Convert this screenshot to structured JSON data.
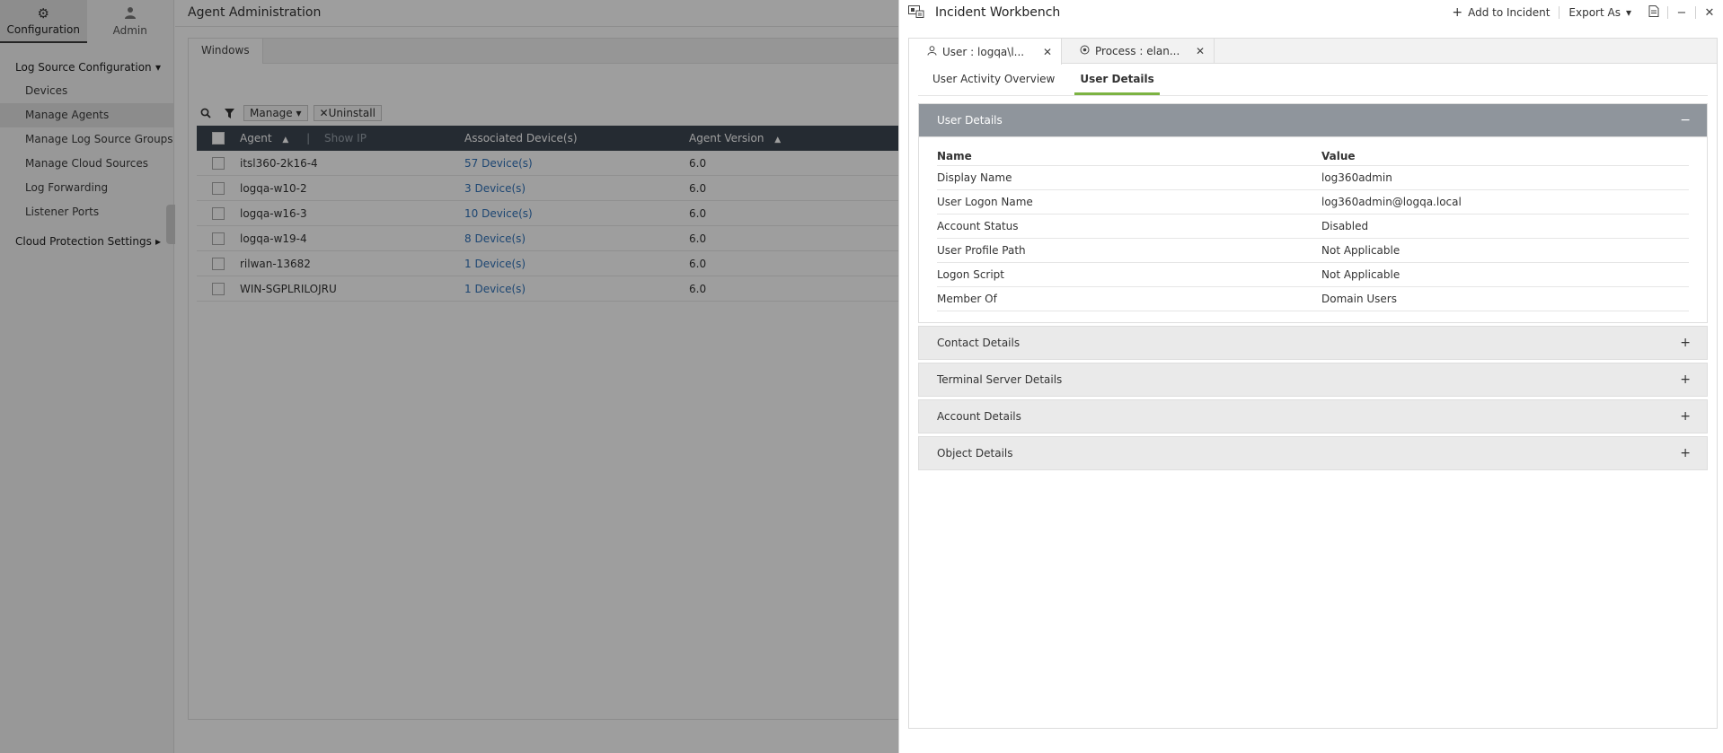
{
  "nav": {
    "modules": [
      {
        "label": "Configuration",
        "icon": "gear-icon"
      },
      {
        "label": "Admin",
        "icon": "user-icon"
      }
    ],
    "group1": "Log Source Configuration",
    "items": [
      "Devices",
      "Manage Agents",
      "Manage Log Source Groups",
      "Manage Cloud Sources",
      "Log Forwarding",
      "Listener Ports"
    ],
    "group2": "Cloud Protection Settings"
  },
  "main": {
    "title": "Agent Administration",
    "tab": "Windows",
    "toolbar": {
      "manage": "Manage",
      "uninstall": "Uninstall"
    },
    "columns": {
      "agent": "Agent",
      "show_ip": "Show IP",
      "devices": "Associated Device(s)",
      "version": "Agent Version"
    },
    "rows": [
      {
        "agent": "itsl360-2k16-4",
        "devices": "57 Device(s)",
        "version": "6.0"
      },
      {
        "agent": "logqa-w10-2",
        "devices": "3 Device(s)",
        "version": "6.0"
      },
      {
        "agent": "logqa-w16-3",
        "devices": "10 Device(s)",
        "version": "6.0"
      },
      {
        "agent": "logqa-w19-4",
        "devices": "8 Device(s)",
        "version": "6.0"
      },
      {
        "agent": "rilwan-13682",
        "devices": "1 Device(s)",
        "version": "6.0"
      },
      {
        "agent": "WIN-SGPLRILOJRU",
        "devices": "1 Device(s)",
        "version": "6.0"
      }
    ]
  },
  "workbench": {
    "title": "Incident Workbench",
    "add_to_incident": "Add to Incident",
    "export_as": "Export As",
    "tabs": [
      {
        "label": "User : logqa\\l...",
        "icon": "user-icon"
      },
      {
        "label": "Process : elan...",
        "icon": "process-icon"
      }
    ],
    "subtabs": [
      "User Activity Overview",
      "User Details"
    ],
    "sections": {
      "user_details": "User Details",
      "contact": "Contact Details",
      "terminal": "Terminal Server Details",
      "account": "Account Details",
      "object": "Object Details"
    },
    "table_head": {
      "name": "Name",
      "value": "Value"
    },
    "details": [
      {
        "name": "Display Name",
        "value": "log360admin"
      },
      {
        "name": "User Logon Name",
        "value": "log360admin@logqa.local"
      },
      {
        "name": "Account Status",
        "value": "Disabled"
      },
      {
        "name": "User Profile Path",
        "value": "Not Applicable"
      },
      {
        "name": "Logon Script",
        "value": "Not Applicable"
      },
      {
        "name": "Member Of",
        "value": "Domain Users"
      }
    ]
  }
}
